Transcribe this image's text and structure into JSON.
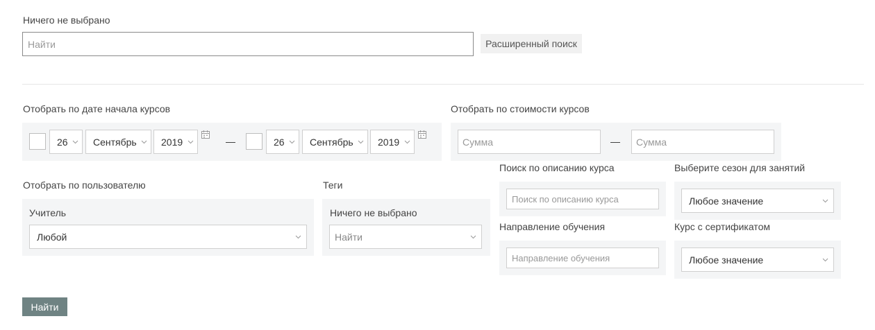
{
  "top": {
    "nothing_selected": "Ничего не выбрано",
    "search_placeholder": "Найти",
    "advanced_search": "Расширенный поиск"
  },
  "date_filter": {
    "label": "Отобрать по дате начала курсов",
    "from": {
      "day": "26",
      "month": "Сентябрь",
      "year": "2019"
    },
    "separator": "—",
    "to": {
      "day": "26",
      "month": "Сентябрь",
      "year": "2019"
    }
  },
  "price_filter": {
    "label": "Отобрать по стоимости курсов",
    "from_placeholder": "Сумма",
    "separator": "—",
    "to_placeholder": "Сумма"
  },
  "user_filter": {
    "label": "Отобрать по пользователю",
    "teacher_label": "Учитель",
    "teacher_value": "Любой"
  },
  "tags": {
    "label": "Теги",
    "nothing_selected": "Ничего не выбрано",
    "search_placeholder": "Найти"
  },
  "description_search": {
    "label": "Поиск по описанию курса",
    "placeholder": "Поиск по описанию курса"
  },
  "season": {
    "label": "Выберите сезон для занятий",
    "value": "Любое значение"
  },
  "direction": {
    "label": "Направление обучения",
    "placeholder": "Направление обучения"
  },
  "certificate": {
    "label": "Курс с сертификатом",
    "value": "Любое значение"
  },
  "submit_label": "Найти"
}
